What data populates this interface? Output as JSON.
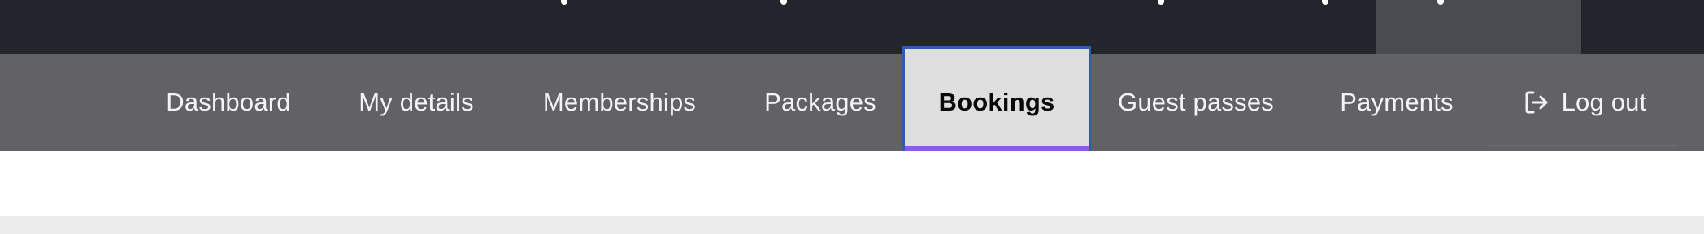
{
  "nav": {
    "items": [
      {
        "label": "Dashboard"
      },
      {
        "label": "My details"
      },
      {
        "label": "Memberships"
      },
      {
        "label": "Packages"
      },
      {
        "label": "Bookings",
        "active": true
      },
      {
        "label": "Guest passes"
      },
      {
        "label": "Payments"
      },
      {
        "label": "Log out",
        "icon": "logout-icon"
      }
    ]
  },
  "colors": {
    "topbar": "#23242c",
    "navbar": "#616166",
    "active_bg": "#dedede",
    "active_underline": "#8a5de3",
    "focus_outline": "#2d5db1"
  }
}
